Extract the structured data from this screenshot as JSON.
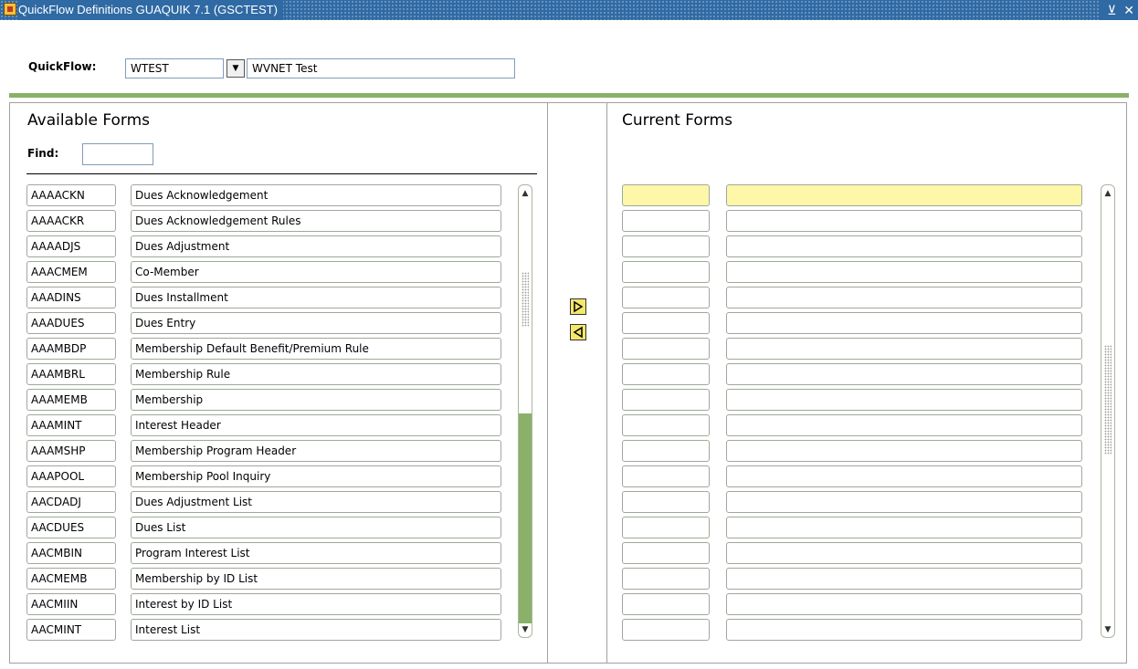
{
  "window": {
    "title": "QuickFlow Definitions  GUAQUIK  7.1  (GSCTEST)",
    "minimize_glyph": "⊻",
    "close_glyph": "✕"
  },
  "quickflow": {
    "label": "QuickFlow:",
    "code": "WTEST",
    "description": "WVNET Test",
    "lov_glyph": "▼"
  },
  "available": {
    "heading": "Available Forms",
    "find_label": "Find:",
    "find_value": "",
    "forms": [
      {
        "code": "AAAACKN",
        "name": "Dues Acknowledgement"
      },
      {
        "code": "AAAACKR",
        "name": "Dues Acknowledgement Rules"
      },
      {
        "code": "AAAADJS",
        "name": "Dues Adjustment"
      },
      {
        "code": "AAACMEM",
        "name": "Co-Member"
      },
      {
        "code": "AAADINS",
        "name": "Dues Installment"
      },
      {
        "code": "AAADUES",
        "name": "Dues Entry"
      },
      {
        "code": "AAAMBDP",
        "name": "Membership Default Benefit/Premium Rule"
      },
      {
        "code": "AAAMBRL",
        "name": "Membership Rule"
      },
      {
        "code": "AAAMEMB",
        "name": "Membership"
      },
      {
        "code": "AAAMINT",
        "name": "Interest Header"
      },
      {
        "code": "AAAMSHP",
        "name": "Membership Program Header"
      },
      {
        "code": "AAAPOOL",
        "name": "Membership Pool Inquiry"
      },
      {
        "code": "AACDADJ",
        "name": "Dues Adjustment List"
      },
      {
        "code": "AACDUES",
        "name": "Dues List"
      },
      {
        "code": "AACMBIN",
        "name": "Program Interest List"
      },
      {
        "code": "AACMEMB",
        "name": "Membership by ID List"
      },
      {
        "code": "AACMIIN",
        "name": "Interest by ID List"
      },
      {
        "code": "AACMINT",
        "name": "Interest List"
      }
    ]
  },
  "transfer": {
    "add_glyph": "▷",
    "remove_glyph": "◁"
  },
  "current": {
    "heading": "Current Forms",
    "row_count": 18
  },
  "scrollbar": {
    "up_glyph": "▲",
    "down_glyph": "▼"
  },
  "colors": {
    "titlebar": "#2f6aa4",
    "accent_green": "#8bb06a",
    "highlight_row": "#fff7a8",
    "arrow_button": "#f3e86a"
  }
}
